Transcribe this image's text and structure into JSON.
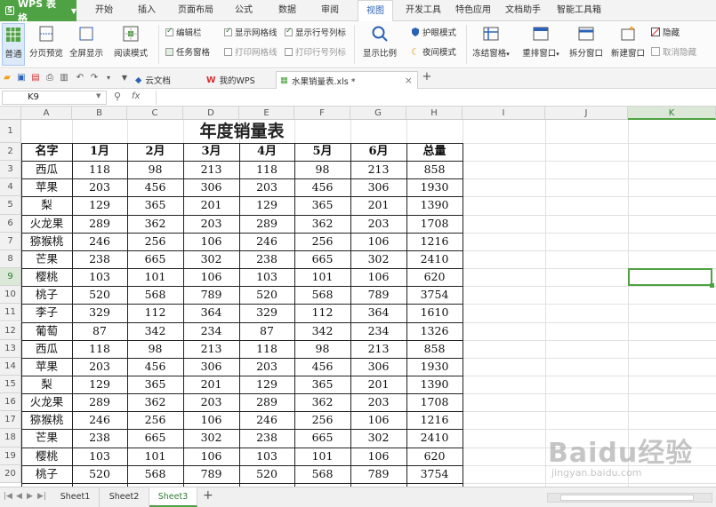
{
  "app": {
    "name": "WPS 表格"
  },
  "menu": [
    "开始",
    "插入",
    "页面布局",
    "公式",
    "数据",
    "审阅",
    "视图",
    "开发工具",
    "特色应用",
    "文档助手",
    "智能工具箱"
  ],
  "active_menu": "视图",
  "ribbon": {
    "normal": "普通",
    "page_break": "分页预览",
    "full_screen": "全屏显示",
    "reading_mode": "阅读模式",
    "edit_bar": "编辑栏",
    "task_pane": "任务窗格",
    "show_gridlines": "显示网格线",
    "print_gridlines": "打印网格线",
    "show_headers": "显示行号列标",
    "print_headers": "打印行号列标",
    "zoom": "显示比例",
    "eye_care": "护眼模式",
    "night_mode": "夜间模式",
    "freeze": "冻结窗格",
    "rearrange": "重排窗口",
    "split": "拆分窗口",
    "new_window": "新建窗口",
    "hide": "隐藏",
    "unhide": "取消隐藏"
  },
  "doc_tabs": [
    "云文档",
    "我的WPS",
    "水果销量表.xls *"
  ],
  "name_box": "K9",
  "fx_label": "fx",
  "columns": [
    "A",
    "B",
    "C",
    "D",
    "E",
    "F",
    "G",
    "H",
    "I",
    "J",
    "K"
  ],
  "selected_column": "K",
  "selected_row": "9",
  "sheet": {
    "title": "年度销量表",
    "headers": [
      "名字",
      "1月",
      "2月",
      "3月",
      "4月",
      "5月",
      "6月",
      "总量"
    ],
    "rows": [
      [
        "西瓜",
        "118",
        "98",
        "213",
        "118",
        "98",
        "213",
        "858"
      ],
      [
        "苹果",
        "203",
        "456",
        "306",
        "203",
        "456",
        "306",
        "1930"
      ],
      [
        "梨",
        "129",
        "365",
        "201",
        "129",
        "365",
        "201",
        "1390"
      ],
      [
        "火龙果",
        "289",
        "362",
        "203",
        "289",
        "362",
        "203",
        "1708"
      ],
      [
        "猕猴桃",
        "246",
        "256",
        "106",
        "246",
        "256",
        "106",
        "1216"
      ],
      [
        "芒果",
        "238",
        "665",
        "302",
        "238",
        "665",
        "302",
        "2410"
      ],
      [
        "樱桃",
        "103",
        "101",
        "106",
        "103",
        "101",
        "106",
        "620"
      ],
      [
        "桃子",
        "520",
        "568",
        "789",
        "520",
        "568",
        "789",
        "3754"
      ],
      [
        "李子",
        "329",
        "112",
        "364",
        "329",
        "112",
        "364",
        "1610"
      ],
      [
        "葡萄",
        "87",
        "342",
        "234",
        "87",
        "342",
        "234",
        "1326"
      ],
      [
        "西瓜",
        "118",
        "98",
        "213",
        "118",
        "98",
        "213",
        "858"
      ],
      [
        "苹果",
        "203",
        "456",
        "306",
        "203",
        "456",
        "306",
        "1930"
      ],
      [
        "梨",
        "129",
        "365",
        "201",
        "129",
        "365",
        "201",
        "1390"
      ],
      [
        "火龙果",
        "289",
        "362",
        "203",
        "289",
        "362",
        "203",
        "1708"
      ],
      [
        "猕猴桃",
        "246",
        "256",
        "106",
        "246",
        "256",
        "106",
        "1216"
      ],
      [
        "芒果",
        "238",
        "665",
        "302",
        "238",
        "665",
        "302",
        "2410"
      ],
      [
        "樱桃",
        "103",
        "101",
        "106",
        "103",
        "101",
        "106",
        "620"
      ],
      [
        "桃子",
        "520",
        "568",
        "789",
        "520",
        "568",
        "789",
        "3754"
      ]
    ]
  },
  "row_numbers": [
    "1",
    "2",
    "3",
    "4",
    "5",
    "6",
    "7",
    "8",
    "9",
    "10",
    "11",
    "12",
    "13",
    "14",
    "15",
    "16",
    "17",
    "18",
    "19",
    "20"
  ],
  "sheet_tabs": [
    "Sheet1",
    "Sheet2",
    "Sheet3"
  ],
  "active_sheet": "Sheet3",
  "watermark": {
    "logo": "Baidu经验",
    "url": "jingyan.baidu.com"
  },
  "colors": {
    "accent": "#4fa243",
    "ribbon_active": "#2b62b6",
    "wps_red": "#d32f2f"
  }
}
